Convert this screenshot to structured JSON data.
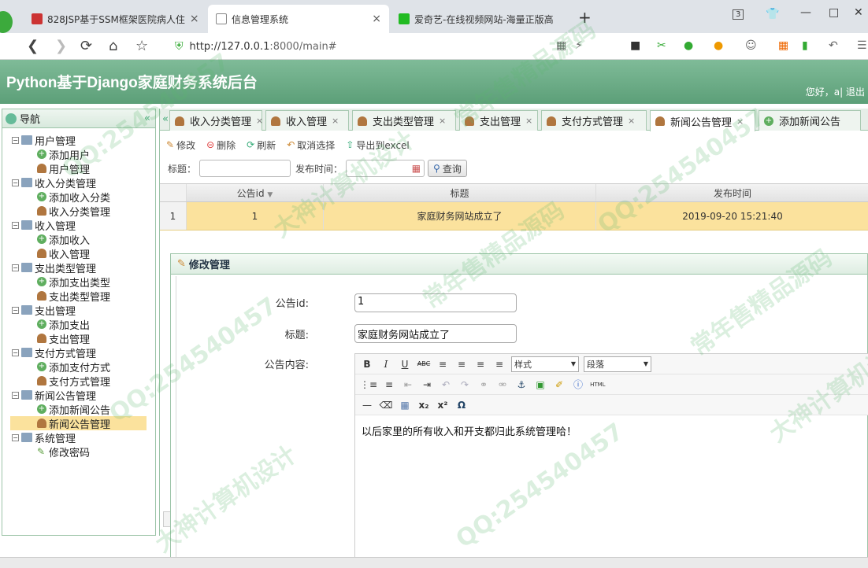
{
  "browser": {
    "tabs": [
      {
        "title": "828JSP基于SSM框架医院病人住",
        "close": "×"
      },
      {
        "title": "信息管理系统",
        "close": "×"
      },
      {
        "title": "爱奇艺-在线视频网站-海量正版高",
        "close": ""
      }
    ],
    "new_tab": "+",
    "tab_count": "3",
    "url_host": "http://127.0.0.1",
    "url_rest": ":8000/main#"
  },
  "app": {
    "title": "Python基于Django家庭财务系统后台",
    "greeting": "您好，a| 退出"
  },
  "sidebar": {
    "title": "导航",
    "collapse": "«",
    "items": [
      {
        "type": "group",
        "label": "用户管理"
      },
      {
        "type": "add",
        "label": "添加用户"
      },
      {
        "type": "user",
        "label": "用户管理"
      },
      {
        "type": "group",
        "label": "收入分类管理"
      },
      {
        "type": "add",
        "label": "添加收入分类"
      },
      {
        "type": "user",
        "label": "收入分类管理"
      },
      {
        "type": "group",
        "label": "收入管理"
      },
      {
        "type": "add",
        "label": "添加收入"
      },
      {
        "type": "user",
        "label": "收入管理"
      },
      {
        "type": "group",
        "label": "支出类型管理"
      },
      {
        "type": "add",
        "label": "添加支出类型"
      },
      {
        "type": "user",
        "label": "支出类型管理"
      },
      {
        "type": "group",
        "label": "支出管理"
      },
      {
        "type": "add",
        "label": "添加支出"
      },
      {
        "type": "user",
        "label": "支出管理"
      },
      {
        "type": "group",
        "label": "支付方式管理"
      },
      {
        "type": "add",
        "label": "添加支付方式"
      },
      {
        "type": "user",
        "label": "支付方式管理"
      },
      {
        "type": "group",
        "label": "新闻公告管理"
      },
      {
        "type": "add",
        "label": "添加新闻公告"
      },
      {
        "type": "user",
        "label": "新闻公告管理",
        "selected": true
      },
      {
        "type": "group",
        "label": "系统管理"
      },
      {
        "type": "pencil",
        "label": "修改密码"
      }
    ]
  },
  "content_tabs": {
    "scroll_left": "«",
    "items": [
      {
        "label": "收入分类管理",
        "icon": "user"
      },
      {
        "label": "收入管理",
        "icon": "user"
      },
      {
        "label": "支出类型管理",
        "icon": "user"
      },
      {
        "label": "支出管理",
        "icon": "user"
      },
      {
        "label": "支付方式管理",
        "icon": "user"
      },
      {
        "label": "新闻公告管理",
        "icon": "user",
        "active": true
      },
      {
        "label": "添加新闻公告",
        "icon": "add"
      }
    ],
    "close": "×"
  },
  "toolbar": {
    "edit": "修改",
    "delete": "删除",
    "refresh": "刷新",
    "cancel_select": "取消选择",
    "export": "导出到excel"
  },
  "search": {
    "title_label": "标题：",
    "date_label": "发布时间：",
    "query_button": "查询"
  },
  "table": {
    "headers": [
      "公告id",
      "标题",
      "发布时间"
    ],
    "rows": [
      {
        "rownum": "1",
        "id": "1",
        "title": "家庭财务网站成立了",
        "time": "2019-09-20 15:21:40"
      }
    ]
  },
  "dialog": {
    "title": "修改管理",
    "id_label": "公告id:",
    "id_value": "1",
    "title_label": "标题:",
    "title_value": "家庭财务网站成立了",
    "content_label": "公告内容:",
    "style_select": "样式",
    "para_select": "段落",
    "html_button": "HTML",
    "content_text": "以后家里的所有收入和开支都归此系统管理哈！"
  },
  "watermarks": [
    "QQ:254540457",
    "常年售精品源码",
    "大神计算机设计",
    "QQ:254540457",
    "QQ:254540457",
    "常年售精品源码",
    "大神计算机设计",
    "QQ:254540457",
    "常年售精品源码",
    "大神计算机设计"
  ],
  "colors": {
    "header": "#6aa985",
    "selected": "#fbe29d",
    "border": "#9cc4a8"
  }
}
